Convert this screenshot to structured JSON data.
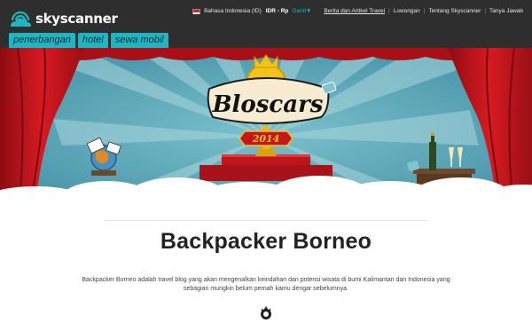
{
  "brand": {
    "name": "skyscanner",
    "logo_icon": "cloud-sun-icon"
  },
  "nav_tabs": [
    {
      "label": "penerbangan"
    },
    {
      "label": "hotel"
    },
    {
      "label": "sewa mobil"
    }
  ],
  "header_links": {
    "flag_icon": "indonesia-flag-icon",
    "language": "Bahasa Indonesia (ID)",
    "currency": "IDR - Rp",
    "change": "Ganti▼",
    "links": [
      "Berita dan Artikel Travel",
      "Lowongan",
      "Tentang Skyscanner",
      "Tanya Jawab"
    ]
  },
  "banner": {
    "title": "Bloscars",
    "year": "2014",
    "colors": {
      "sky": "#5aa6b8",
      "curtain": "#c8141c",
      "stage": "#b3121a",
      "gold": "#f0c419"
    }
  },
  "page": {
    "title": "Backpacker Borneo",
    "description_line1": "Backpacker Borneo adalah  travel blog yang akan mengenalkan keindahan dan potensi wisata di bumi Kalimantan dan Indonesia yang",
    "description_line2": "sebagian mungkin belum pernah kamu dengar sebelumnya."
  },
  "colors": {
    "topbar": "#2e2e2e",
    "tab": "#1fb6c4",
    "title_text": "#222222"
  }
}
